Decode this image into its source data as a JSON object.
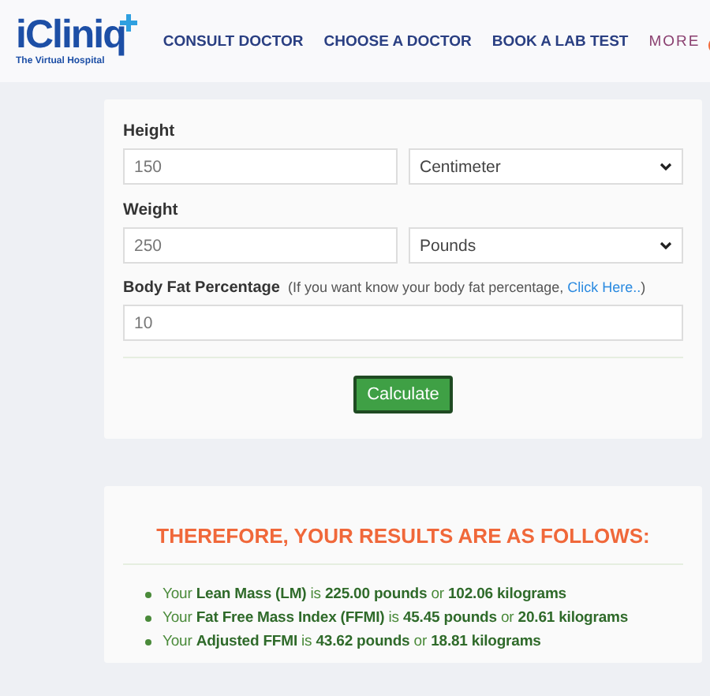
{
  "header": {
    "logo": {
      "name": "iCliniq",
      "tagline": "The Virtual Hospital"
    },
    "nav": [
      {
        "label": "CONSULT DOCTOR",
        "kind": "link"
      },
      {
        "label": "CHOOSE A DOCTOR",
        "kind": "link"
      },
      {
        "label": "BOOK A LAB TEST",
        "kind": "link"
      },
      {
        "label": "MORE",
        "kind": "more"
      }
    ]
  },
  "form": {
    "fields": [
      {
        "label": "Height",
        "value": "150",
        "unit": "Centimeter"
      },
      {
        "label": "Weight",
        "value": "250",
        "unit": "Pounds"
      }
    ],
    "body_fat": {
      "label": "Body Fat Percentage",
      "hint": "(If you want know your body fat percentage, ",
      "link": "Click Here..",
      "hint_end": ")",
      "value": "10"
    },
    "button": "Calculate"
  },
  "results": {
    "title": "THEREFORE, YOUR RESULTS ARE AS FOLLOWS:",
    "items": [
      "Your **Lean Mass (LM)** is **225.00 pounds** or **102.06 kilograms**",
      "Your **Fat Free Mass Index (FFMI)** is **45.45 pounds** or **20.61 kilograms**",
      "Your **Adjusted FFMI** is **43.62 pounds** or **18.81 kilograms**"
    ]
  }
}
